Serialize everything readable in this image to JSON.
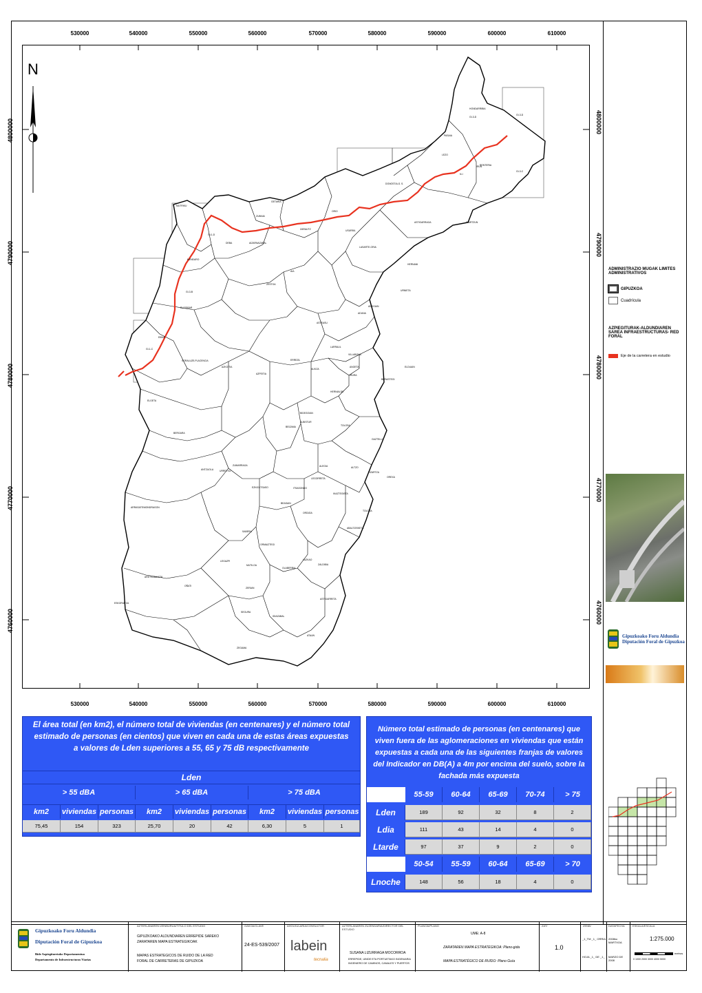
{
  "map": {
    "north_label": "N",
    "x_ticks": [
      "530000",
      "540000",
      "550000",
      "560000",
      "570000",
      "580000",
      "590000",
      "600000",
      "610000"
    ],
    "y_ticks": [
      "4800000",
      "4790000",
      "4780000",
      "4770000",
      "4760000"
    ],
    "municipalities": [
      "HONDARRIBIA",
      "GI-3-D",
      "IRUN",
      "PASAIA",
      "LEZO",
      "RENTERIA",
      "DONOSTIA-S. S.",
      "GETARIA",
      "MUTRIKU",
      "ZUMAIA",
      "ORIO",
      "ZARAUTZ",
      "USURBIL",
      "ASTIGARRAGA",
      "OIARTZUN",
      "DEBA",
      "AIZARNAZABAL",
      "HERNANI",
      "LASARTE-ORIA",
      "MENDARO",
      "AIA",
      "ZESTOA",
      "ANDOAIN",
      "URNIETA",
      "ELGOIBAR",
      "ADUNA",
      "ASTEASU",
      "EIBAR",
      "SORALUZE-PLACENCIA",
      "LARRAUL",
      "VILLABONA",
      "ERREZIL",
      "AZKOITIA",
      "AZPEITIA",
      "ALKIZA",
      "ANOETA",
      "IRURA",
      "BERASTEGI",
      "ELDUAIN",
      "HERNIALDE",
      "ELGETA",
      "BIDEGOIAN",
      "ALBISTUR",
      "TOLOSA",
      "BEIZAMA",
      "BERGARA",
      "GAZTELU",
      "ANTZUOLA",
      "URRETXU",
      "ZUMARRAGA",
      "ALEGIA",
      "ALTZO",
      "LIZARTZA",
      "OREXA",
      "LEGORRETA",
      "EZKIO-ITSASO",
      "ITSASONDO",
      "IKAZTEGIETA",
      "ARRASATE/MONDRAGON",
      "BEASAIN",
      "ORDIZIA",
      "TOLOSA",
      "SABERA",
      "ABALTZISKETA",
      "ORMAIZTEGI",
      "LAZKAO",
      "ZALDIBIA",
      "OLABERRIA",
      "LEGAZPI",
      "MUTILOA",
      "ARETXABALETA",
      "OÑATI",
      "ZERAIN",
      "ESKORIATZA",
      "SEGURA",
      "IDIAZABAL",
      "ATAUN",
      "ASTIGARRETA",
      "ZEGAMA"
    ],
    "grid_labels": [
      "GI-3-D",
      "GI-3-C",
      "GI-1-D",
      "GI-1-C",
      "GI-3-B",
      "N-I"
    ]
  },
  "legend": {
    "section1_title": "ADMINISTRAZIO MUGAK LIMITES ADMINISTRATIVOS",
    "gipuzkoa_label": "GIPUZKOA",
    "cuadricula_label": "Cuadrícula",
    "section2_title": "AZPIEGITURAK-ALDUNDIAREN SAREA INFRAESTRUCTURAS- RED FORAL",
    "road_label": "Eje de la carretera en estudio",
    "road_color": "#e8321f",
    "org_eu": "Gipuzkoako Foru Aldundia",
    "org_es": "Diputación Foral de Gipuzkoa"
  },
  "table_left": {
    "title": "El área total (en km2), el número total de viviendas (en centenares) y el número total estimado de personas (en cientos) que viven en cada una de estas áreas expuestas a valores de Lden superiores a 55, 65 y 75 dB respectivamente",
    "header": "Lden",
    "bands": [
      "> 55 dBA",
      "> 65 dBA",
      "> 75 dBA"
    ],
    "cols": [
      "km2",
      "viviendas",
      "personas",
      "km2",
      "viviendas",
      "personas",
      "km2",
      "viviendas",
      "personas"
    ],
    "values": [
      "75,45",
      "154",
      "323",
      "25,70",
      "20",
      "42",
      "6,30",
      "5",
      "1"
    ]
  },
  "table_right": {
    "title": "Número total estimado de personas (en centenares) que viven fuera de las aglomeraciones en viviendas que están expuestas a cada una de las siguientes franjas de valores del Indicador en DB(A) a 4m por encima del suelo, sobre la fachada más expuesta",
    "bands_day": [
      "55-59",
      "60-64",
      "65-69",
      "70-74",
      "> 75"
    ],
    "rows": [
      {
        "label": "Lden",
        "values": [
          "189",
          "92",
          "32",
          "8",
          "2"
        ]
      },
      {
        "label": "Ldia",
        "values": [
          "111",
          "43",
          "14",
          "4",
          "0"
        ]
      },
      {
        "label": "Ltarde",
        "values": [
          "97",
          "37",
          "9",
          "2",
          "0"
        ]
      }
    ],
    "bands_night": [
      "50-54",
      "55-59",
      "60-64",
      "65-69",
      "> 70"
    ],
    "night": {
      "label": "Lnoche",
      "values": [
        "148",
        "56",
        "18",
        "4",
        "0"
      ]
    }
  },
  "footer": {
    "org_eu": "Gipuzkoako Foru Aldundia",
    "org_es": "Diputación Foral de Gipuzkoa",
    "dept_eu": "Bide Azpiegituretako Departamentua",
    "dept_es": "Departamento de Infraestructuras Viarias",
    "project_label": "AZTERLANAREN IZENBURUA/TITULO DEL ESTUDIO",
    "project_1": "GIPUZKOAKO ALDUNDIAREN ERREPIDE SAREKO",
    "project_2": "ZARATAREN MAPA ESTRATEGIKOAK",
    "project_3": "MAPAS ESTRATEGICOS DE RUIDO DE LA RED",
    "project_4": "FORAL DE CARRETERAS DE GIPUZKOA",
    "code_label": "GAKOA/CLAVE",
    "code": "24-ES-539/2007",
    "consultant_label": "AHOLKULARIA/CONSULTOR",
    "consultant": "labein",
    "consultant_sub": "tecnalia",
    "engineer_label": "AZTERLANAREN ZUZENDARIA/DIRECTOR DEL ESTUDIO",
    "engineer": "SUSANA LIZURRAGA MOCORROA",
    "engineer_title_1": "ERREPIDE, UBIDE ETA PORTUETAKO INGENIARIA",
    "engineer_title_2": "INGENIERO DE CAMINOS, CANALES Y PUERTOS",
    "plan_label": "PLANOA/PLANO",
    "plan_1": "UME: A-8",
    "plan_2": "ZARATAREN MAPA ESTRATEGIKOA: Plano-gida",
    "plan_3": "MAPA ESTRATÉGICO DE RUIDO: Plano Guía",
    "version_label": "ZAT/",
    "version": "1.0",
    "sheet_label": "ZENB/",
    "sheet_1": "_1_TM _1_ ORRIA",
    "sheet_2": "HOJA _1_ DE _1_",
    "date_label": "DATAFECHA",
    "date_1": "2008ko MARTXOA",
    "date_2": "MARZO DE 2008",
    "scale_label": "ESKALA/ESCALA",
    "scale": "1:275.000",
    "scale_metro": "metros",
    "scale_ticks": "0 1000 2000 3000 4000 5000"
  }
}
